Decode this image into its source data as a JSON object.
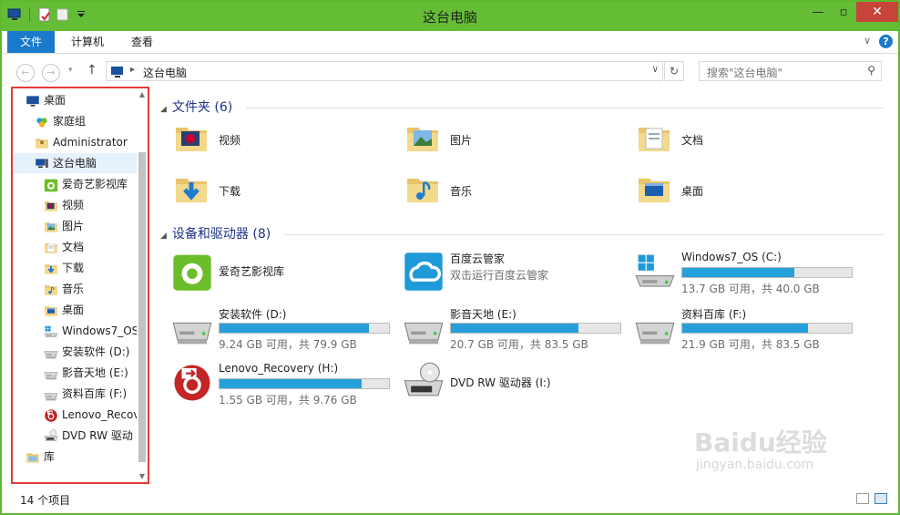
{
  "window": {
    "title": "这台电脑"
  },
  "ribbon": {
    "tabs": [
      "文件",
      "计算机",
      "查看"
    ]
  },
  "address": {
    "path": "这台电脑"
  },
  "search": {
    "placeholder": "搜索\"这台电脑\""
  },
  "nav": {
    "items": [
      {
        "label": "桌面",
        "icon": "desktop-icon",
        "level": 0
      },
      {
        "label": "家庭组",
        "icon": "homegroup-icon",
        "level": 1
      },
      {
        "label": "Administrator",
        "icon": "user-folder-icon",
        "level": 1
      },
      {
        "label": "这台电脑",
        "icon": "computer-icon",
        "level": 1,
        "selected": true
      },
      {
        "label": "爱奇艺影视库",
        "icon": "iqiyi-icon",
        "level": 2
      },
      {
        "label": "视频",
        "icon": "folder-videos-icon",
        "level": 2
      },
      {
        "label": "图片",
        "icon": "folder-pictures-icon",
        "level": 2
      },
      {
        "label": "文档",
        "icon": "folder-documents-icon",
        "level": 2
      },
      {
        "label": "下载",
        "icon": "folder-downloads-icon",
        "level": 2
      },
      {
        "label": "音乐",
        "icon": "folder-music-icon",
        "level": 2
      },
      {
        "label": "桌面",
        "icon": "folder-desktop-icon",
        "level": 2
      },
      {
        "label": "Windows7_OS",
        "icon": "windows-drive-icon",
        "level": 2
      },
      {
        "label": "安装软件 (D:)",
        "icon": "drive-icon",
        "level": 2
      },
      {
        "label": "影音天地 (E:)",
        "icon": "drive-icon",
        "level": 2
      },
      {
        "label": "资料百库 (F:)",
        "icon": "drive-icon",
        "level": 2
      },
      {
        "label": "Lenovo_Recovery",
        "icon": "recovery-drive-icon",
        "level": 2
      },
      {
        "label": "DVD RW 驱动",
        "icon": "dvd-drive-icon",
        "level": 2
      },
      {
        "label": "库",
        "icon": "libraries-icon",
        "level": 0
      }
    ]
  },
  "folders_group": {
    "title": "文件夹 (6)"
  },
  "folders": [
    {
      "label": "视频",
      "icon": "folder-videos-icon"
    },
    {
      "label": "图片",
      "icon": "folder-pictures-icon"
    },
    {
      "label": "文档",
      "icon": "folder-documents-icon"
    },
    {
      "label": "下载",
      "icon": "folder-downloads-icon"
    },
    {
      "label": "音乐",
      "icon": "folder-music-icon"
    },
    {
      "label": "桌面",
      "icon": "folder-desktop-icon"
    }
  ],
  "devices_group": {
    "title": "设备和驱动器 (8)"
  },
  "devices": [
    {
      "name": "爱奇艺影视库",
      "icon": "iqiyi-icon"
    },
    {
      "name": "百度云管家",
      "sub": "双击运行百度云管家",
      "icon": "baidu-cloud-icon"
    },
    {
      "name": "Windows7_OS (C:)",
      "info": "13.7 GB 可用，共 40.0 GB",
      "used": 0.66,
      "icon": "windows-drive-icon"
    },
    {
      "name": "安装软件 (D:)",
      "info": "9.24 GB 可用，共 79.9 GB",
      "used": 0.88,
      "icon": "drive-icon"
    },
    {
      "name": "影音天地 (E:)",
      "info": "20.7 GB 可用，共 83.5 GB",
      "used": 0.75,
      "icon": "drive-icon"
    },
    {
      "name": "资料百库 (F:)",
      "info": "21.9 GB 可用，共 83.5 GB",
      "used": 0.74,
      "icon": "drive-icon"
    },
    {
      "name": "Lenovo_Recovery (H:)",
      "info": "1.55 GB 可用，共 9.76 GB",
      "used": 0.84,
      "icon": "recovery-drive-icon"
    },
    {
      "name": "DVD RW 驱动器 (I:)",
      "icon": "dvd-drive-icon"
    }
  ],
  "status": {
    "count": "14 个项目"
  },
  "watermark": {
    "brand": "Baidu经验",
    "url": "jingyan.baidu.com"
  },
  "colors": {
    "titlebar": "#64bd35",
    "accent": "#1979ca",
    "drive_bar": "#26a0da",
    "highlight_box": "#e53a3a"
  }
}
